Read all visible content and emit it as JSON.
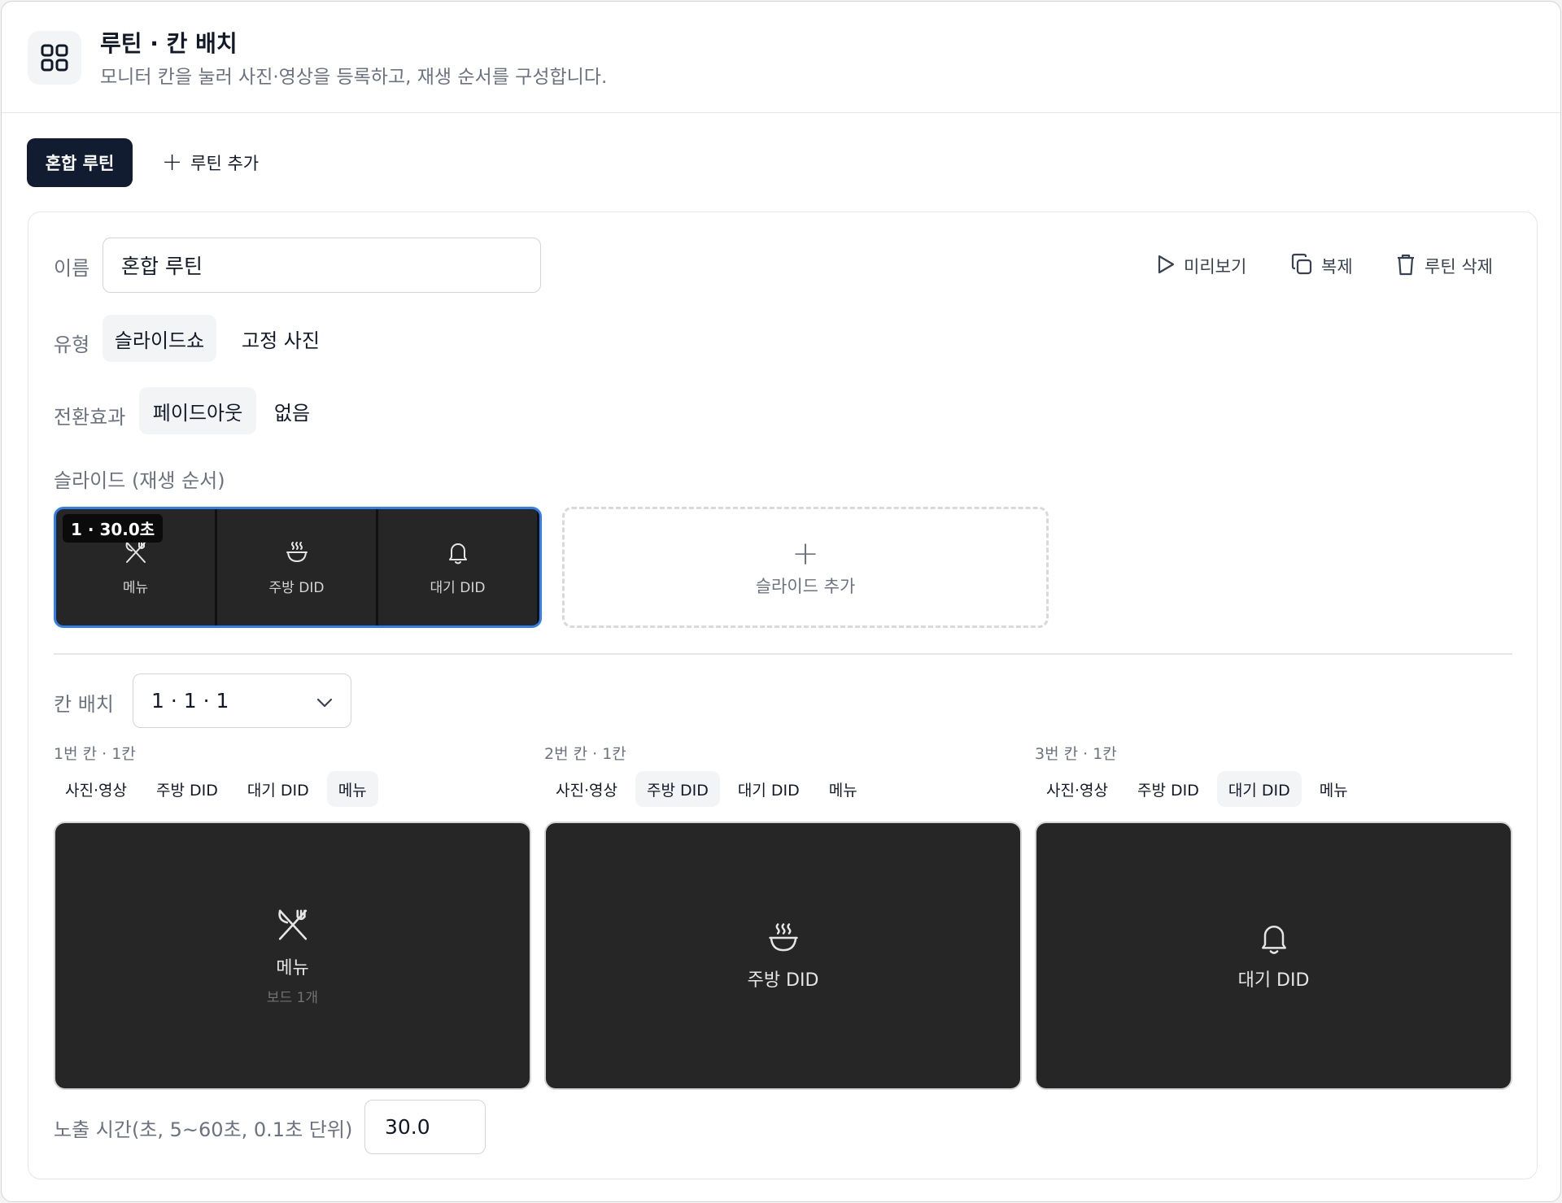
{
  "header": {
    "title": "루틴 · 칸 배치",
    "subtitle": "모니터 칸을 눌러 사진·영상을 등록하고, 재생 순서를 구성합니다.",
    "icon": "grid-icon"
  },
  "routine_tabs": {
    "active": "혼합 루틴",
    "add": "루틴 추가"
  },
  "editor": {
    "name_label": "이름",
    "name_value": "혼합 루틴",
    "actions": {
      "preview": "미리보기",
      "duplicate": "복제",
      "delete": "루틴 삭제"
    },
    "type_label": "유형",
    "type_options": [
      "슬라이드쇼",
      "고정 사진"
    ],
    "type_selected": "슬라이드쇼",
    "transition_label": "전환효과",
    "transition_options": [
      "페이드아웃",
      "없음"
    ],
    "transition_selected": "페이드아웃",
    "slides_label": "슬라이드 (재생 순서)",
    "slides": [
      {
        "badge": "1 · 30.0초",
        "cells": [
          {
            "label": "메뉴",
            "icon": "utensils-icon"
          },
          {
            "label": "주방 DID",
            "icon": "bowl-icon"
          },
          {
            "label": "대기 DID",
            "icon": "bell-icon"
          }
        ]
      }
    ],
    "add_slide": "슬라이드 추가",
    "layout_label": "칸 배치",
    "layout_value": "1 · 1 · 1",
    "columns": [
      {
        "title": "1번 칸 · 1칸",
        "options": [
          "사진·영상",
          "주방 DID",
          "대기 DID",
          "메뉴"
        ],
        "selected": "메뉴",
        "screen_label": "메뉴",
        "screen_sub": "보드 1개",
        "icon": "utensils-icon"
      },
      {
        "title": "2번 칸 · 1칸",
        "options": [
          "사진·영상",
          "주방 DID",
          "대기 DID",
          "메뉴"
        ],
        "selected": "주방 DID",
        "screen_label": "주방 DID",
        "screen_sub": "",
        "icon": "bowl-icon"
      },
      {
        "title": "3번 칸 · 1칸",
        "options": [
          "사진·영상",
          "주방 DID",
          "대기 DID",
          "메뉴"
        ],
        "selected": "대기 DID",
        "screen_label": "대기 DID",
        "screen_sub": "",
        "icon": "bell-icon"
      }
    ],
    "duration_label": "노출 시간(초, 5~60초, 0.1초 단위)",
    "duration_value": "30.0"
  },
  "colors": {
    "active_tab": "#111c30",
    "slide_border": "#2f80ed",
    "screen_bg": "#262626"
  }
}
